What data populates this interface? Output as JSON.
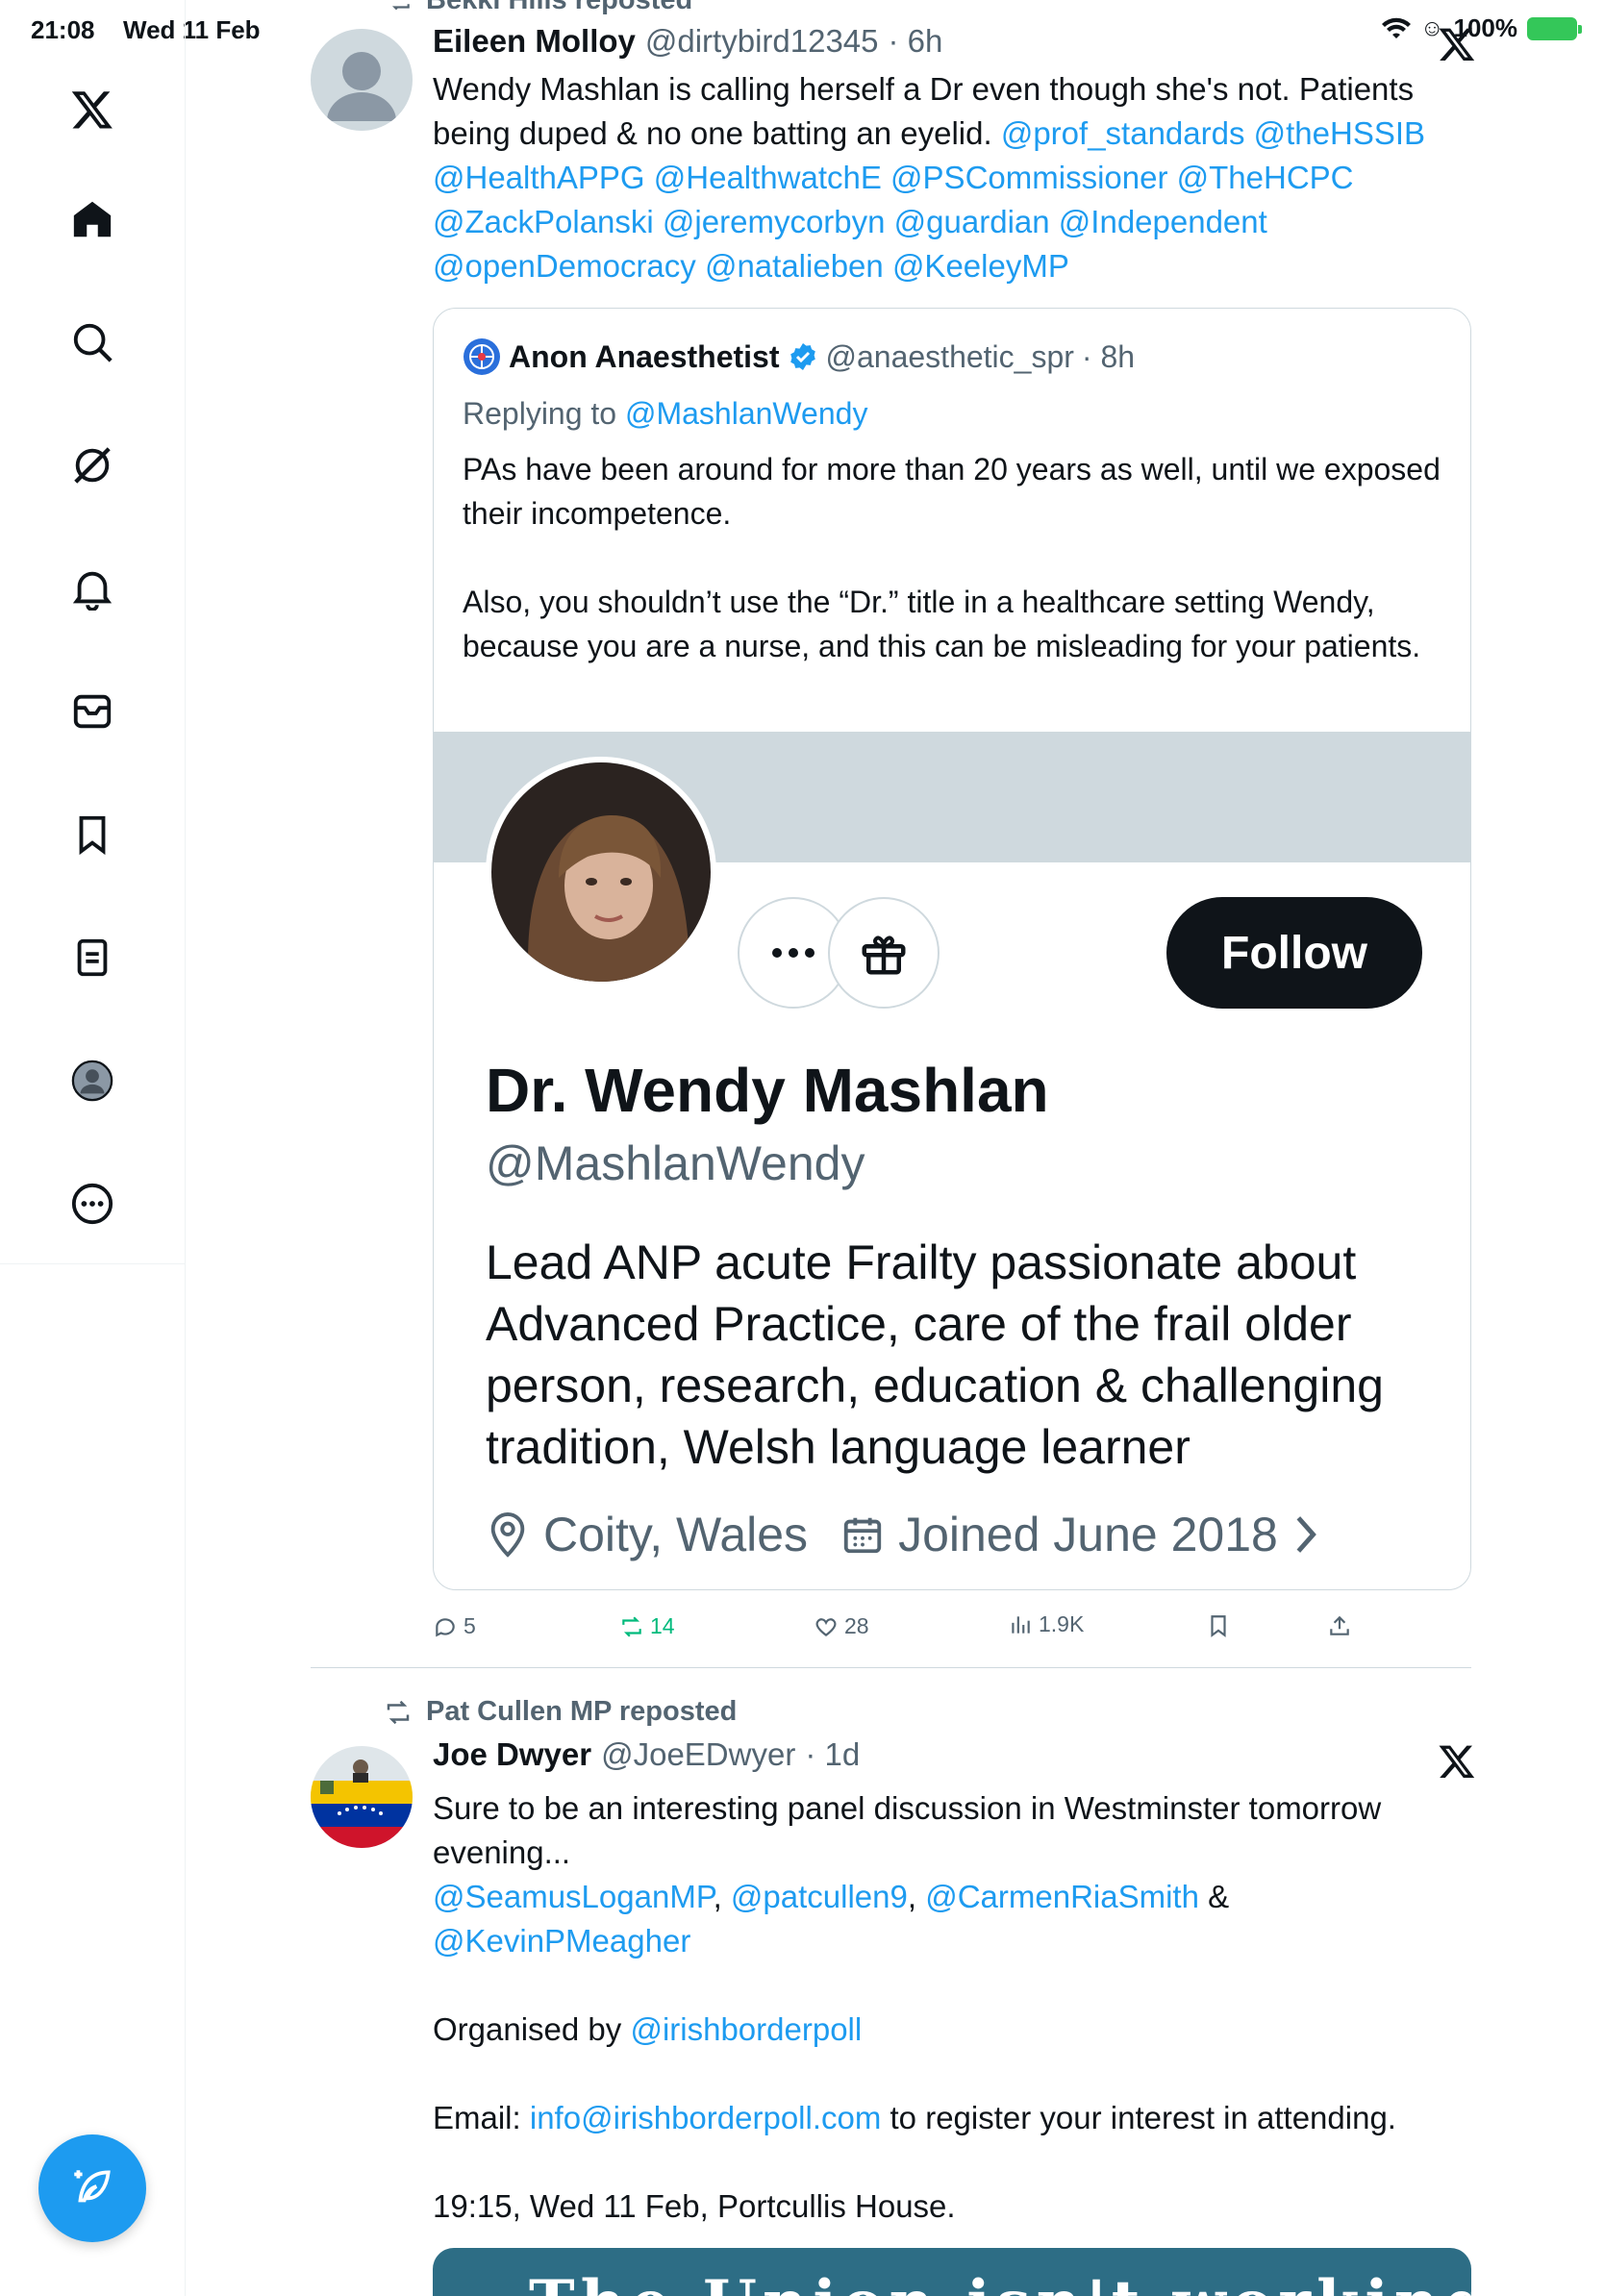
{
  "status": {
    "time": "21:08",
    "date": "Wed 11 Feb",
    "battery": "100%"
  },
  "nav": [
    "x-logo",
    "home",
    "search",
    "grok",
    "notifications",
    "messages",
    "bookmarks",
    "lists",
    "profile",
    "more"
  ],
  "top_repost_label": "Bekki Hills reposted",
  "tweet1": {
    "name": "Eileen Molloy",
    "handle": "@dirtybird12345",
    "time": "· 6h",
    "text": "Wendy Mashlan is calling herself a Dr even though she's not. Patients being duped & no one batting an eyelid.",
    "mentions": [
      "@prof_standards",
      "@theHSSIB",
      "@HealthAPPG",
      "@HealthwatchE",
      "@PSCommissioner",
      "@TheHCPC",
      "@ZackPolanski",
      "@jeremycorbyn",
      "@guardian",
      "@Independent",
      "@openDemocracy",
      "@natalieben",
      "@KeeleyMP"
    ],
    "quote": {
      "name": "Anon Anaesthetist",
      "handle": "@anaesthetic_spr",
      "time": "· 8h",
      "replying_label": "Replying to",
      "replying_handle": "@MashlanWendy",
      "para1": "PAs have been around for more than 20 years as well, until we exposed their incompetence.",
      "para2": "Also, you shouldn’t use the “Dr.” title in a healthcare setting Wendy, because you are a nurse, and this can be misleading for your patients.",
      "profile": {
        "follow": "Follow",
        "name": "Dr. Wendy Mashlan",
        "handle": "@MashlanWendy",
        "bio": "Lead ANP acute Frailty passionate about Advanced Practice, care of the frail older person, research, education & challenging tradition, Welsh language learner",
        "location": "Coity, Wales",
        "joined": "Joined June 2018"
      }
    },
    "stats": {
      "replies": "5",
      "reposts": "14",
      "likes": "28",
      "views": "1.9K"
    }
  },
  "tweet2": {
    "repost_label": "Pat Cullen MP reposted",
    "name": "Joe Dwyer",
    "handle": "@JoeEDwyer",
    "time": "· 1d",
    "line1": "Sure to be an interesting panel discussion in Westminster tomorrow evening...",
    "mentions": [
      "@SeamusLoganMP",
      ", ",
      "@patcullen9",
      ", ",
      "@CarmenRiaSmith",
      " & ",
      "@KevinPMeagher"
    ],
    "organised_label": "Organised by",
    "organised_handle": "@irishborderpoll",
    "email_label": "Email:",
    "email": "info@irishborderpoll.com",
    "email_suffix": "to register your interest in attending.",
    "event_line": "19:15, Wed 11 Feb, Portcullis House.",
    "image_text": "The Union isn't working"
  },
  "colors": {
    "accent": "#1d9bf0",
    "text": "#0f1419",
    "muted": "#536471",
    "repost_green": "#00ba7c"
  }
}
